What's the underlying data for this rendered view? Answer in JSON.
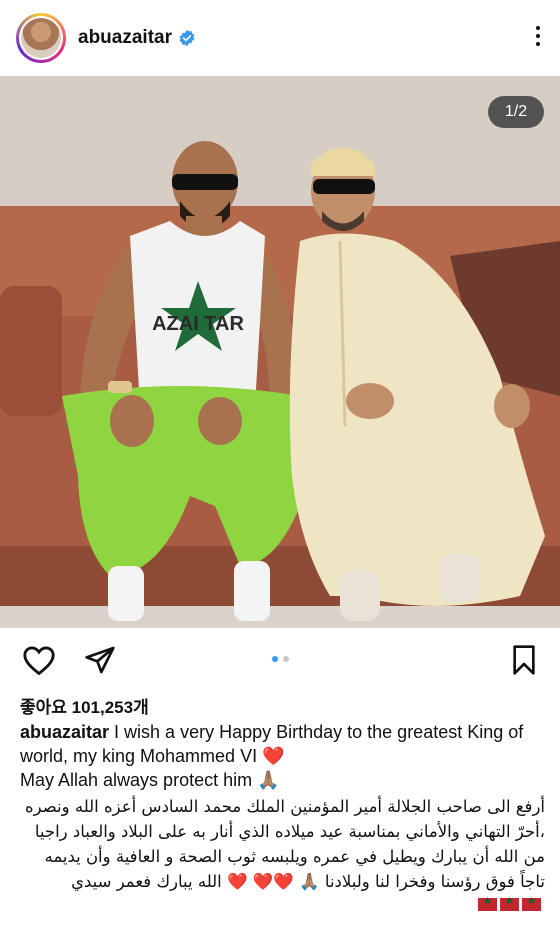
{
  "header": {
    "username": "abuazaitar",
    "more_icon": "more-vertical-icon"
  },
  "post": {
    "counter": "1/2",
    "shirt_text": "AZAI TAR",
    "carousel_total": 2,
    "carousel_active": 1
  },
  "actions": {
    "like_icon": "heart-outline-icon",
    "share_icon": "paper-plane-icon",
    "save_icon": "bookmark-icon"
  },
  "likes": "좋아요 101,253개",
  "caption": {
    "username": "abuazaitar",
    "line1": " I wish a very Happy Birthday to the greatest King of world, my king Mohammed VI ",
    "heart": "❤️",
    "line2": "May Allah always protect him 🙏🏽",
    "arabic": "أرفع الى صاحب الجلالة أمير المؤمنين الملك محمد السادس أعزه الله ونصره ،أحرّ التهاني والأماني بمناسبة عيد ميلاده الذي أنار به على البلاد والعباد راجيا من الله أن يبارك ويطيل في عمره ويلبسه ثوب الصحة و العافية وأن يديمه تاجاً فوق رؤسنا وفخرا لنا ولبلادنا 🙏🏽 ❤️❤️ ❤️ الله يبارك فعمر سيدي"
  },
  "colors": {
    "accent": "#3897f0",
    "heart": "#e0245e",
    "flag_red": "#c1272d",
    "flag_green": "#006233"
  }
}
